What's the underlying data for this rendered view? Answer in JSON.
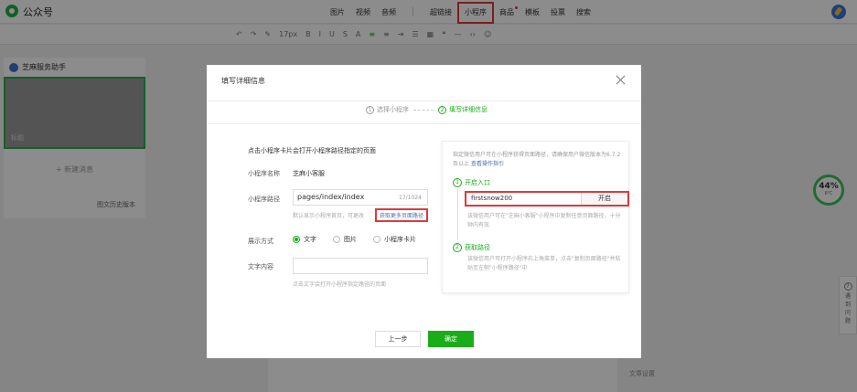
{
  "header": {
    "brand": "公众号",
    "menu": [
      "图片",
      "视频",
      "音频",
      "超链接",
      "小程序",
      "商品",
      "模板",
      "投票",
      "搜索"
    ]
  },
  "toolbar": {
    "font_size": "17px"
  },
  "left_panel": {
    "account_name": "芝麻服务助手",
    "cover_label": "标题",
    "add_article": "+ 新建消息",
    "history": "图文历史版本"
  },
  "right_float": {
    "score": "44%",
    "temp": "6℃",
    "help": "遇到问题",
    "settings": "文章设置"
  },
  "modal": {
    "title": "填写详细信息",
    "steps": [
      {
        "num": "1",
        "label": "选择小程序"
      },
      {
        "num": "2",
        "label": "填写详细信息"
      }
    ],
    "hint": "点击小程序卡片会打开小程序路径指定的页面",
    "name_label": "小程序名称",
    "name_value": "芝麻小客服",
    "path_label": "小程序路径",
    "path_value": "pages/index/index",
    "path_counter": "17/1024",
    "path_tip": "默认显示小程序首页，可更改",
    "get_path_link": "获取更多页面路径",
    "display_label": "展示方式",
    "display_options": [
      "文字",
      "图片",
      "小程序卡片"
    ],
    "text_label": "文字内容",
    "text_tip": "点击文字会打开小程序指定路径的页面",
    "prev_button": "上一步",
    "ok_button": "确定"
  },
  "side_panel": {
    "desc": "指定微信用户可在小程序获得页面路径，请确保用户微信版本为6.7.2及以上",
    "desc_link": "查看操作指引",
    "step1_num": "1",
    "step1_title": "开启入口",
    "field_value": "firstsnow200",
    "field_button": "开启",
    "note1": "该微信用户可在\"芝麻小客服\"小程序中复制任意页面路径，十分钟内有效",
    "step2_num": "2",
    "step2_title": "获取路径",
    "note2": "该微信用户可打开小程序右上角菜单，点击\"复制页面路径\"并粘贴至左侧\"小程序路径\"中"
  }
}
